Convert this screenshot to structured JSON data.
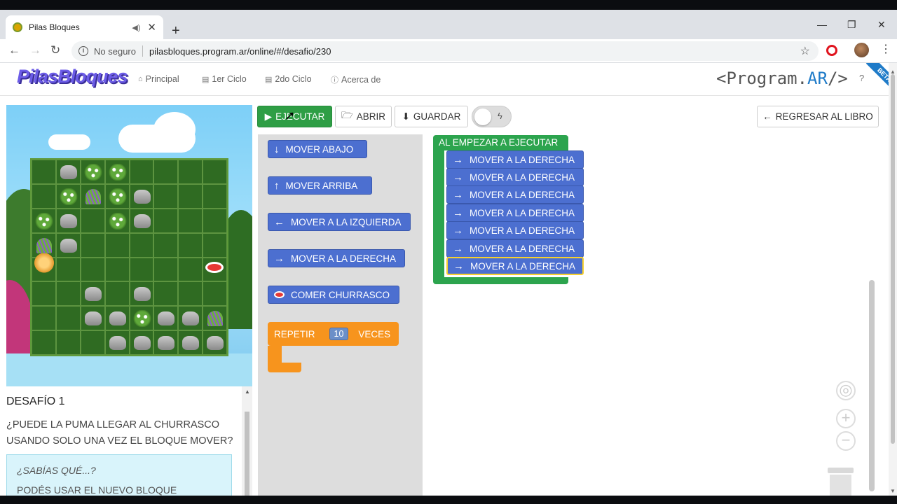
{
  "browser": {
    "tab_title": "Pilas Bloques",
    "new_tab_icon": "+",
    "window_controls": [
      "—",
      "❐",
      "✕"
    ],
    "security_label": "No seguro",
    "url": "pilasbloques.program.ar/online/#/desafio/230"
  },
  "header": {
    "logo": "PilasBloques",
    "nav": [
      {
        "label": "Principal",
        "icon": "home-icon"
      },
      {
        "label": "1er Ciclo",
        "icon": "book-icon"
      },
      {
        "label": "2do Ciclo",
        "icon": "book-icon"
      },
      {
        "label": "Acerca de",
        "icon": "info-icon"
      }
    ],
    "brand_prefix": "<Program.",
    "brand_ar": "AR",
    "brand_suffix": "/>",
    "help": "?",
    "beta": "BETA"
  },
  "toolbar": {
    "run": "EJECUTAR",
    "open": "ABRIR",
    "save": "GUARDAR",
    "back": "REGRESAR AL LIBRO"
  },
  "toolbox": {
    "move_down": "MOVER ABAJO",
    "move_up": "MOVER ARRIBA",
    "move_left": "MOVER A LA IZQUIERDA",
    "move_right": "MOVER A LA DERECHA",
    "eat": "COMER CHURRASCO",
    "repeat_label": "REPETIR",
    "repeat_times": "10",
    "repeat_suffix": "VECES"
  },
  "workspace": {
    "event_label": "AL EMPEZAR A EJECUTAR",
    "program": [
      "MOVER A LA DERECHA",
      "MOVER A LA DERECHA",
      "MOVER A LA DERECHA",
      "MOVER A LA DERECHA",
      "MOVER A LA DERECHA",
      "MOVER A LA DERECHA",
      "MOVER A LA DERECHA"
    ]
  },
  "challenge": {
    "title": "DESAFÍO 1",
    "description": "¿PUEDE LA PUMA LLEGAR AL CHURRASCO USANDO SOLO UNA VEZ EL BLOQUE MOVER?",
    "tip_title": "¿SABÍAS QUÉ...?",
    "tip_body": "PODÉS USAR EL NUEVO BLOQUE"
  },
  "colors": {
    "run_green": "#2e9e45",
    "block_blue": "#4c6fd0",
    "event_green": "#2ca44e",
    "repeat_orange": "#f7941d",
    "brand_purple": "#6c5ce7"
  }
}
